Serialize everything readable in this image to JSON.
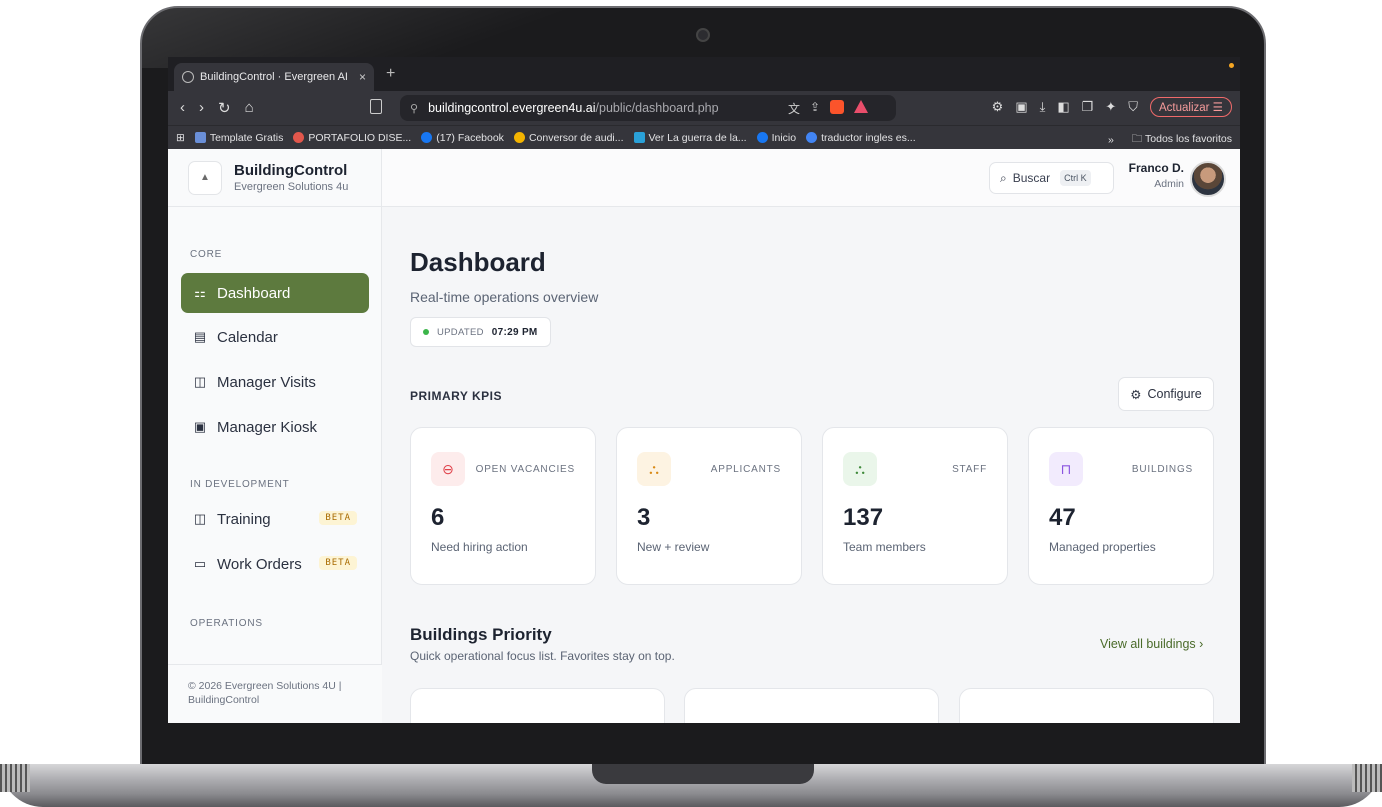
{
  "browser": {
    "tab_title": "BuildingControl · Evergreen AI",
    "tab_close": "×",
    "new_tab": "+",
    "url_domain": "buildingcontrol.evergreen4u.ai",
    "url_path": "/public/dashboard.php",
    "update_button": "Actualizar",
    "bookmarks": [
      {
        "label": "Template Gratis",
        "color": "#6a8fd8"
      },
      {
        "label": "PORTAFOLIO DISE...",
        "color": "#e2574c"
      },
      {
        "label": "(17) Facebook",
        "color": "#1877f2"
      },
      {
        "label": "Conversor de audi...",
        "color": "#f4b400"
      },
      {
        "label": "Ver La guerra de la...",
        "color": "#2aa1d8"
      },
      {
        "label": "Inicio",
        "color": "#1877f2"
      },
      {
        "label": "traductor ingles es...",
        "color": "#4285f4"
      }
    ],
    "bookmarks_more": "»",
    "all_bookmarks": "Todos los favoritos"
  },
  "brand": {
    "name": "BuildingControl",
    "subtitle": "Evergreen Solutions 4u"
  },
  "sidebar": {
    "sections": {
      "core": "CORE",
      "in_development": "IN DEVELOPMENT",
      "operations": "OPERATIONS"
    },
    "items": [
      {
        "label": "Dashboard",
        "icon": "grid-icon",
        "active": true
      },
      {
        "label": "Calendar",
        "icon": "calendar-icon"
      },
      {
        "label": "Manager Visits",
        "icon": "map-icon"
      },
      {
        "label": "Manager Kiosk",
        "icon": "kiosk-icon"
      },
      {
        "label": "Training",
        "icon": "book-icon",
        "badge": "BETA"
      },
      {
        "label": "Work Orders",
        "icon": "document-icon",
        "badge": "BETA"
      }
    ],
    "footer": "© 2026 Evergreen Solutions 4U | BuildingControl"
  },
  "topbar": {
    "search_label": "Buscar",
    "search_shortcut": "Ctrl K",
    "user_name": "Franco D.",
    "user_role": "Admin"
  },
  "main": {
    "title": "Dashboard",
    "subtitle": "Real-time operations overview",
    "updated_label": "UPDATED",
    "updated_time": "07:29 PM",
    "kpi_heading": "PRIMARY KPIS",
    "configure": "Configure",
    "kpis": [
      {
        "label": "OPEN VACANCIES",
        "value": "6",
        "desc": "Need hiring action",
        "icon": "vacancy-icon",
        "color": "#e0424b",
        "bg": "#fdecec"
      },
      {
        "label": "APPLICANTS",
        "value": "3",
        "desc": "New + review",
        "icon": "people-icon",
        "color": "#d98a16",
        "bg": "#fdf3e2"
      },
      {
        "label": "STAFF",
        "value": "137",
        "desc": "Team members",
        "icon": "team-icon",
        "color": "#3f8a3a",
        "bg": "#eaf6ea"
      },
      {
        "label": "BUILDINGS",
        "value": "47",
        "desc": "Managed properties",
        "icon": "building-icon",
        "color": "#8b55e0",
        "bg": "#f2ebfd"
      }
    ],
    "buildings_title": "Buildings Priority",
    "buildings_subtitle": "Quick operational focus list. Favorites stay on top.",
    "view_all": "View all buildings"
  }
}
